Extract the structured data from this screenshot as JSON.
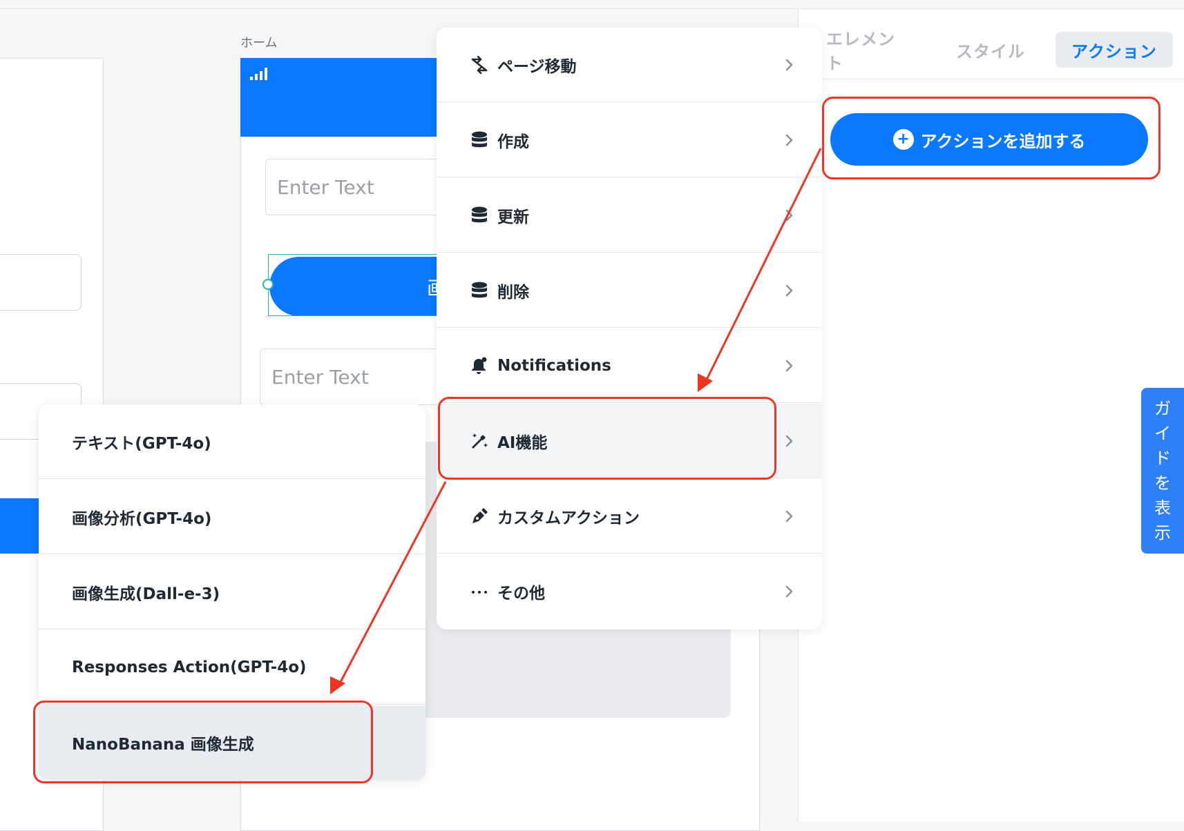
{
  "canvas": {
    "screen_label": "ホーム",
    "text_field_placeholder_1": "Enter Text",
    "text_field_placeholder_2": "Enter Text",
    "button_partial_text": "画"
  },
  "tabs": [
    {
      "label": "エレメント",
      "active": false
    },
    {
      "label": "スタイル",
      "active": false
    },
    {
      "label": "アクション",
      "active": true
    }
  ],
  "add_action_button": {
    "label": "アクションを追加する",
    "icon": "plus-circle-icon"
  },
  "guide_tab": {
    "chars": [
      "ガ",
      "イ",
      "ド",
      "を",
      "表",
      "示"
    ]
  },
  "action_menu": {
    "items": [
      {
        "label": "ページ移動",
        "icon": "navigate-icon"
      },
      {
        "label": "作成",
        "icon": "database-icon"
      },
      {
        "label": "更新",
        "icon": "database-icon"
      },
      {
        "label": "削除",
        "icon": "database-icon"
      },
      {
        "label": "Notifications",
        "icon": "bell-icon"
      },
      {
        "label": "AI機能",
        "icon": "magic-wand-icon",
        "highlighted": true
      },
      {
        "label": "カスタムアクション",
        "icon": "pen-icon"
      },
      {
        "label": "その他",
        "icon": "ellipsis-icon"
      }
    ]
  },
  "ai_submenu": {
    "items": [
      {
        "label": "テキスト(GPT-4o)"
      },
      {
        "label": "画像分析(GPT-4o)"
      },
      {
        "label": "画像生成(Dall-e-3)"
      },
      {
        "label": "Responses Action(GPT-4o)"
      },
      {
        "label": "NanoBanana 画像生成",
        "highlighted": true
      }
    ]
  },
  "colors": {
    "accent": "#0a78ff",
    "annotation": "#ee3524"
  }
}
